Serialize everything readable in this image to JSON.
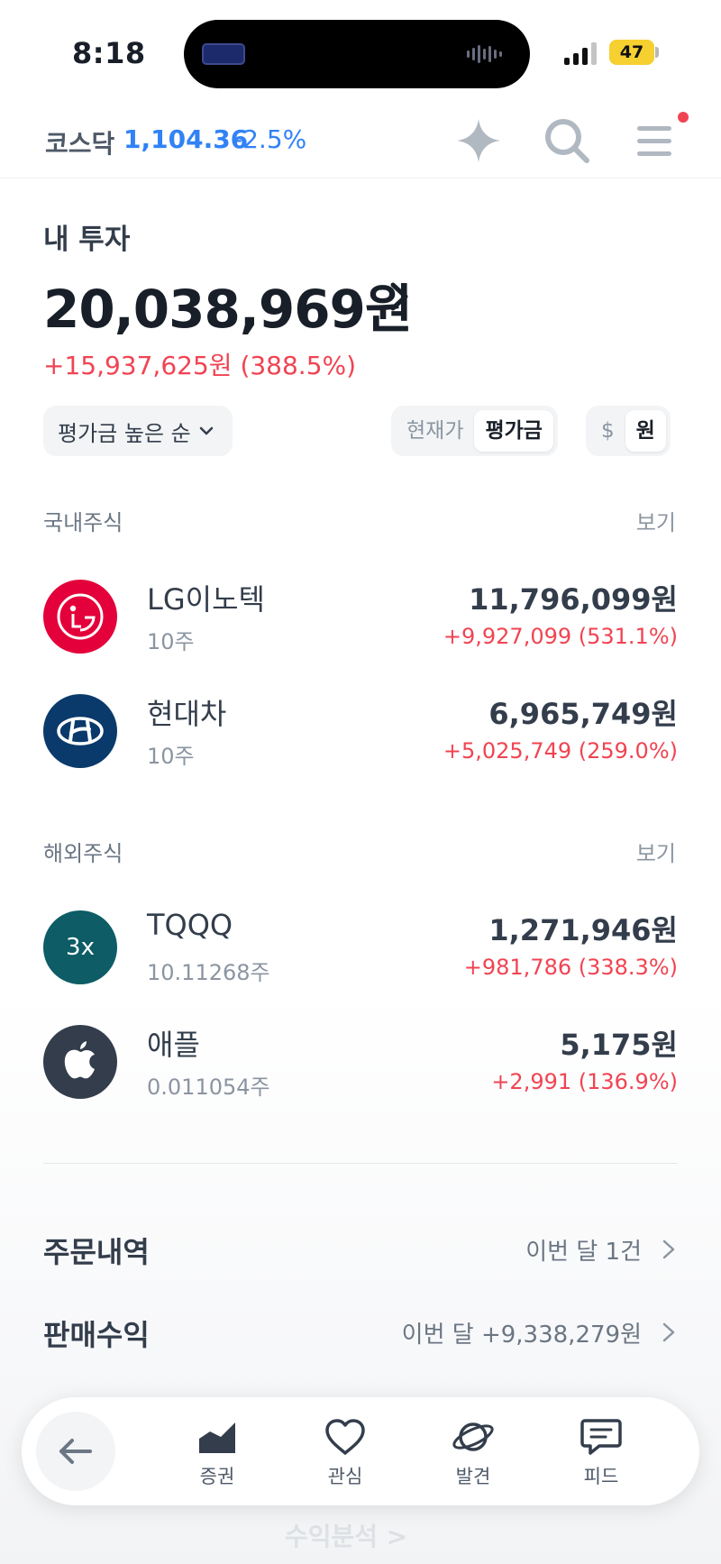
{
  "status_bar": {
    "time": "8:18",
    "battery": "47"
  },
  "header": {
    "market_name": "코스닥",
    "market_value": "1,104.36",
    "market_change": "-2.5%"
  },
  "investment": {
    "label": "내 투자",
    "total": "20,038,969원",
    "gain": "+15,937,625원 (388.5%)"
  },
  "controls": {
    "sort_label": "평가금 높은 순",
    "price_mode": [
      "현재가",
      "평가금"
    ],
    "currency_mode": [
      "$",
      "원"
    ]
  },
  "domestic": {
    "title": "국내주식",
    "view_label": "보기",
    "stocks": [
      {
        "name": "LG이노텍",
        "qty": "10주",
        "value": "11,796,099원",
        "gain": "+9,927,099 (531.1%)",
        "logo_color": "#e4003a"
      },
      {
        "name": "현대차",
        "qty": "10주",
        "value": "6,965,749원",
        "gain": "+5,025,749 (259.0%)",
        "logo_color": "#0a3a6b"
      }
    ]
  },
  "overseas": {
    "title": "해외주식",
    "view_label": "보기",
    "stocks": [
      {
        "name": "TQQQ",
        "qty": "10.11268주",
        "value": "1,271,946원",
        "gain": "+981,786 (338.3%)",
        "logo_text": "3x",
        "logo_color": "#0d5c66"
      },
      {
        "name": "애플",
        "qty": "0.011054주",
        "value": "5,175원",
        "gain": "+2,991 (136.9%)",
        "logo_color": "#333d4b"
      }
    ]
  },
  "summary": {
    "orders_label": "주문내역",
    "orders_value": "이번 달 1건",
    "sales_label": "판매수익",
    "sales_value": "이번 달 +9,338,279원",
    "peek_label": "수익분석 >"
  },
  "bottom_nav": {
    "items": [
      "증권",
      "관심",
      "발견",
      "피드"
    ]
  },
  "colors": {
    "up": "#f04452",
    "down": "#3182f6",
    "text": "#333d4b"
  }
}
